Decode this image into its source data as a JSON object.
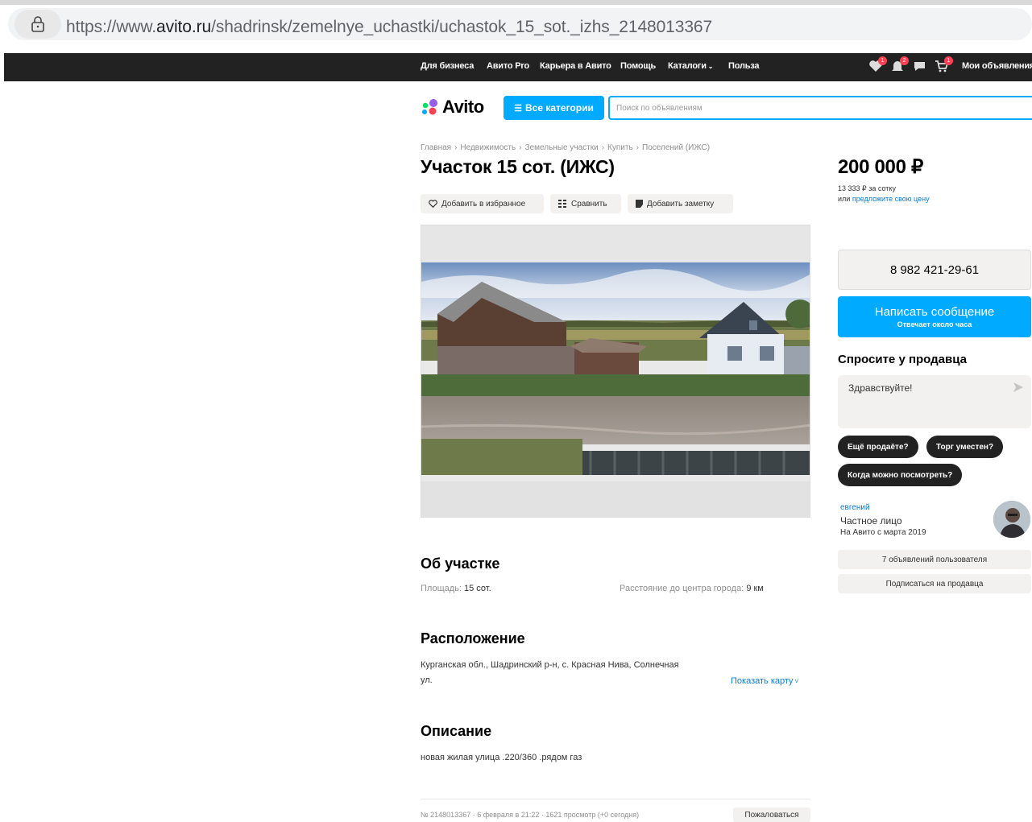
{
  "browser": {
    "url_prefix": "https://www.",
    "url_domain": "avito.ru",
    "url_path": "/shadrinsk/zemelnye_uchastki/uchastok_15_sot._izhs_2148013367"
  },
  "topnav": {
    "items": [
      "Для бизнеса",
      "Авито Pro",
      "Карьера в Авито",
      "Помощь",
      "Каталоги",
      "Польза"
    ],
    "badges": [
      "1",
      "2",
      "1"
    ],
    "my_ads": "Мои объявления"
  },
  "header": {
    "logo": "Avito",
    "categories_button": "Все категории",
    "search_placeholder": "Поиск по объявлениям"
  },
  "breadcrumb": [
    "Главная",
    "Недвижимость",
    "Земельные участки",
    "Купить",
    "Поселений (ИЖС)"
  ],
  "listing": {
    "title": "Участок 15 сот. (ИЖС)",
    "actions": {
      "favorite": "Добавить в избранное",
      "compare": "Сравнить",
      "note": "Добавить заметку"
    }
  },
  "about": {
    "title": "Об участке",
    "area_label": "Площадь:",
    "area_value": "15 сот.",
    "distance_label": "Расстояние до центра города:",
    "distance_value": "9 км"
  },
  "location": {
    "title": "Расположение",
    "address_line1": "Курганская обл., Шадринский р-н, с. Красная Нива, Солнечная",
    "address_line2": "ул.",
    "show_map": "Показать карту"
  },
  "description": {
    "title": "Описание",
    "text": "новая жилая улица .220/360 .рядом газ"
  },
  "footer": {
    "info": "№ 2148013367 · 6 февраля в 21:22 · 1621 просмотр (+0 сегодня)",
    "report": "Пожаловаться"
  },
  "sidebar": {
    "price": "200 000 ₽",
    "price_per_sotka": "13 333 ₽ за сотку",
    "offer_prefix": "или",
    "offer_link": "предложите свою цену",
    "phone": "8 982 421-29-61",
    "message_button": "Написать сообщение",
    "message_sub": "Отвечает около часа",
    "ask_title": "Спросите у продавца",
    "ask_text": "Здравствуйте!",
    "quick_questions": [
      "Ещё продаёте?",
      "Торг уместен?",
      "Когда можно посмотреть?"
    ],
    "seller_name": "евгений",
    "seller_type": "Частное лицо",
    "seller_since": "На Авито с марта 2019",
    "user_ads": "7 объявлений пользователя",
    "subscribe": "Подписаться на продавца"
  },
  "colors": {
    "accent": "#00aaff",
    "link": "#0a7cd1",
    "topbar": "#222222",
    "badge": "#ff4053"
  }
}
